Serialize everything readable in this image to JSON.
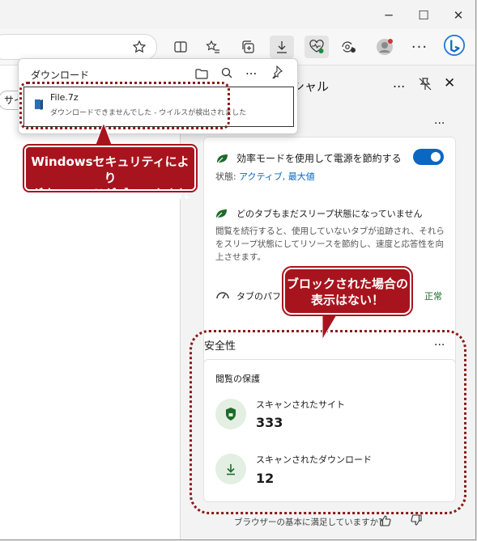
{
  "window": {
    "minimize_icon": "─",
    "maximize_icon": "☐",
    "close_icon": "✕"
  },
  "toolbar": {
    "icons": [
      "star-icon",
      "split-screen-icon",
      "favorites-icon",
      "collections-icon",
      "download-icon",
      "browser-essentials-icon",
      "browser-essentials-check-icon",
      "profile-icon",
      "more-icon",
      "copilot-icon"
    ]
  },
  "left_tab_fragment": "サイ",
  "download": {
    "title": "ダウンロード",
    "file_name": "File.7z",
    "status": "ダウンロードできませんでした - ウイルスが検出されました"
  },
  "panel": {
    "title_fragment": "シャル",
    "efficiency": {
      "label": "効率モードを使用して電源を節約する",
      "state_label": "状態:",
      "state_value": "アクティブ, 最大値",
      "sleep_title": "どのタブもまだスリープ状態になっていません",
      "sleep_desc": "閲覧を続行すると、使用していないタブが追跡され、それらをスリープ状態にしてリソースを節約し、速度と応答性を向上させます。",
      "perf_label": "タブのパフォー",
      "perf_status": "正常"
    },
    "safety": {
      "title": "安全性",
      "card_title": "閲覧の保護",
      "sites_label": "スキャンされたサイト",
      "sites_value": "333",
      "downloads_label": "スキャンされたダウンロード",
      "downloads_value": "12"
    },
    "feedback": "ブラウザーの基本に満足していますか?",
    "more": "..."
  },
  "annotations": {
    "callout1_line1": "Windowsセキュリティにより",
    "callout1_line2": "ダウンロードがブロックされた",
    "callout2_line1": "ブロックされた場合の",
    "callout2_line2": "表示はない！"
  },
  "colors": {
    "accent": "#0a67c2",
    "annotation": "#a8141e",
    "green": "#1d6b2a"
  }
}
